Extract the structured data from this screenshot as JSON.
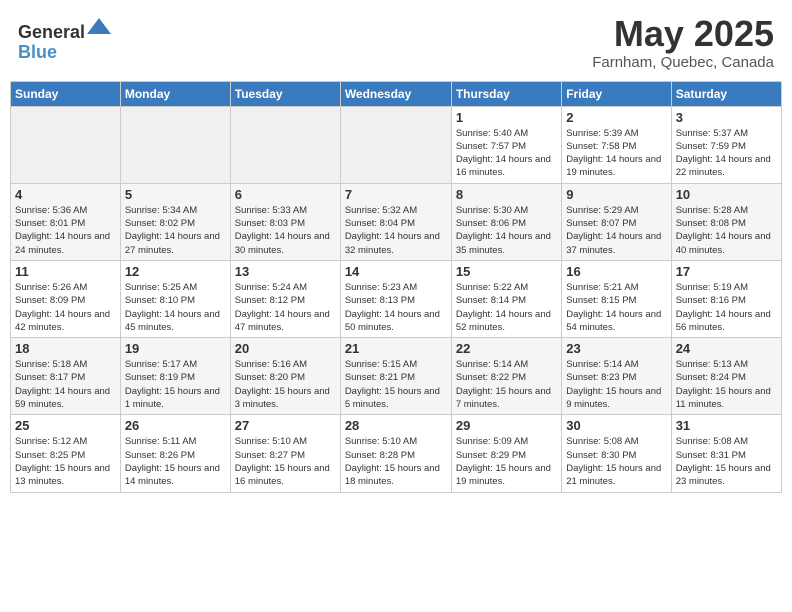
{
  "header": {
    "logo_general": "General",
    "logo_blue": "Blue",
    "month_title": "May 2025",
    "subtitle": "Farnham, Quebec, Canada"
  },
  "weekdays": [
    "Sunday",
    "Monday",
    "Tuesday",
    "Wednesday",
    "Thursday",
    "Friday",
    "Saturday"
  ],
  "weeks": [
    [
      {
        "day": "",
        "empty": true
      },
      {
        "day": "",
        "empty": true
      },
      {
        "day": "",
        "empty": true
      },
      {
        "day": "",
        "empty": true
      },
      {
        "day": "1",
        "sunrise": "Sunrise: 5:40 AM",
        "sunset": "Sunset: 7:57 PM",
        "daylight": "Daylight: 14 hours and 16 minutes."
      },
      {
        "day": "2",
        "sunrise": "Sunrise: 5:39 AM",
        "sunset": "Sunset: 7:58 PM",
        "daylight": "Daylight: 14 hours and 19 minutes."
      },
      {
        "day": "3",
        "sunrise": "Sunrise: 5:37 AM",
        "sunset": "Sunset: 7:59 PM",
        "daylight": "Daylight: 14 hours and 22 minutes."
      }
    ],
    [
      {
        "day": "4",
        "sunrise": "Sunrise: 5:36 AM",
        "sunset": "Sunset: 8:01 PM",
        "daylight": "Daylight: 14 hours and 24 minutes."
      },
      {
        "day": "5",
        "sunrise": "Sunrise: 5:34 AM",
        "sunset": "Sunset: 8:02 PM",
        "daylight": "Daylight: 14 hours and 27 minutes."
      },
      {
        "day": "6",
        "sunrise": "Sunrise: 5:33 AM",
        "sunset": "Sunset: 8:03 PM",
        "daylight": "Daylight: 14 hours and 30 minutes."
      },
      {
        "day": "7",
        "sunrise": "Sunrise: 5:32 AM",
        "sunset": "Sunset: 8:04 PM",
        "daylight": "Daylight: 14 hours and 32 minutes."
      },
      {
        "day": "8",
        "sunrise": "Sunrise: 5:30 AM",
        "sunset": "Sunset: 8:06 PM",
        "daylight": "Daylight: 14 hours and 35 minutes."
      },
      {
        "day": "9",
        "sunrise": "Sunrise: 5:29 AM",
        "sunset": "Sunset: 8:07 PM",
        "daylight": "Daylight: 14 hours and 37 minutes."
      },
      {
        "day": "10",
        "sunrise": "Sunrise: 5:28 AM",
        "sunset": "Sunset: 8:08 PM",
        "daylight": "Daylight: 14 hours and 40 minutes."
      }
    ],
    [
      {
        "day": "11",
        "sunrise": "Sunrise: 5:26 AM",
        "sunset": "Sunset: 8:09 PM",
        "daylight": "Daylight: 14 hours and 42 minutes."
      },
      {
        "day": "12",
        "sunrise": "Sunrise: 5:25 AM",
        "sunset": "Sunset: 8:10 PM",
        "daylight": "Daylight: 14 hours and 45 minutes."
      },
      {
        "day": "13",
        "sunrise": "Sunrise: 5:24 AM",
        "sunset": "Sunset: 8:12 PM",
        "daylight": "Daylight: 14 hours and 47 minutes."
      },
      {
        "day": "14",
        "sunrise": "Sunrise: 5:23 AM",
        "sunset": "Sunset: 8:13 PM",
        "daylight": "Daylight: 14 hours and 50 minutes."
      },
      {
        "day": "15",
        "sunrise": "Sunrise: 5:22 AM",
        "sunset": "Sunset: 8:14 PM",
        "daylight": "Daylight: 14 hours and 52 minutes."
      },
      {
        "day": "16",
        "sunrise": "Sunrise: 5:21 AM",
        "sunset": "Sunset: 8:15 PM",
        "daylight": "Daylight: 14 hours and 54 minutes."
      },
      {
        "day": "17",
        "sunrise": "Sunrise: 5:19 AM",
        "sunset": "Sunset: 8:16 PM",
        "daylight": "Daylight: 14 hours and 56 minutes."
      }
    ],
    [
      {
        "day": "18",
        "sunrise": "Sunrise: 5:18 AM",
        "sunset": "Sunset: 8:17 PM",
        "daylight": "Daylight: 14 hours and 59 minutes."
      },
      {
        "day": "19",
        "sunrise": "Sunrise: 5:17 AM",
        "sunset": "Sunset: 8:19 PM",
        "daylight": "Daylight: 15 hours and 1 minute."
      },
      {
        "day": "20",
        "sunrise": "Sunrise: 5:16 AM",
        "sunset": "Sunset: 8:20 PM",
        "daylight": "Daylight: 15 hours and 3 minutes."
      },
      {
        "day": "21",
        "sunrise": "Sunrise: 5:15 AM",
        "sunset": "Sunset: 8:21 PM",
        "daylight": "Daylight: 15 hours and 5 minutes."
      },
      {
        "day": "22",
        "sunrise": "Sunrise: 5:14 AM",
        "sunset": "Sunset: 8:22 PM",
        "daylight": "Daylight: 15 hours and 7 minutes."
      },
      {
        "day": "23",
        "sunrise": "Sunrise: 5:14 AM",
        "sunset": "Sunset: 8:23 PM",
        "daylight": "Daylight: 15 hours and 9 minutes."
      },
      {
        "day": "24",
        "sunrise": "Sunrise: 5:13 AM",
        "sunset": "Sunset: 8:24 PM",
        "daylight": "Daylight: 15 hours and 11 minutes."
      }
    ],
    [
      {
        "day": "25",
        "sunrise": "Sunrise: 5:12 AM",
        "sunset": "Sunset: 8:25 PM",
        "daylight": "Daylight: 15 hours and 13 minutes."
      },
      {
        "day": "26",
        "sunrise": "Sunrise: 5:11 AM",
        "sunset": "Sunset: 8:26 PM",
        "daylight": "Daylight: 15 hours and 14 minutes."
      },
      {
        "day": "27",
        "sunrise": "Sunrise: 5:10 AM",
        "sunset": "Sunset: 8:27 PM",
        "daylight": "Daylight: 15 hours and 16 minutes."
      },
      {
        "day": "28",
        "sunrise": "Sunrise: 5:10 AM",
        "sunset": "Sunset: 8:28 PM",
        "daylight": "Daylight: 15 hours and 18 minutes."
      },
      {
        "day": "29",
        "sunrise": "Sunrise: 5:09 AM",
        "sunset": "Sunset: 8:29 PM",
        "daylight": "Daylight: 15 hours and 19 minutes."
      },
      {
        "day": "30",
        "sunrise": "Sunrise: 5:08 AM",
        "sunset": "Sunset: 8:30 PM",
        "daylight": "Daylight: 15 hours and 21 minutes."
      },
      {
        "day": "31",
        "sunrise": "Sunrise: 5:08 AM",
        "sunset": "Sunset: 8:31 PM",
        "daylight": "Daylight: 15 hours and 23 minutes."
      }
    ]
  ]
}
